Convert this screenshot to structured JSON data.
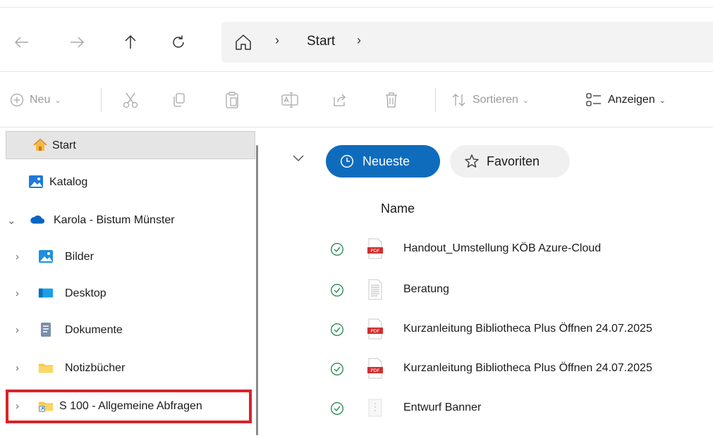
{
  "nav": {
    "breadcrumb": [
      "Start"
    ]
  },
  "toolbar": {
    "new_label": "Neu",
    "sort_label": "Sortieren",
    "view_label": "Anzeigen"
  },
  "sidebar": {
    "items": [
      {
        "label": "Start",
        "icon": "home-icon",
        "selected": true
      },
      {
        "label": "Katalog",
        "icon": "gallery-icon"
      },
      {
        "label": "Karola - Bistum Münster",
        "icon": "onedrive-cloud-icon",
        "expanded": true
      },
      {
        "label": "Bilder",
        "icon": "pictures-folder-icon"
      },
      {
        "label": "Desktop",
        "icon": "desktop-folder-icon"
      },
      {
        "label": "Dokumente",
        "icon": "documents-folder-icon"
      },
      {
        "label": "Notizbücher",
        "icon": "folder-icon"
      },
      {
        "label": "S 100 - Allgemeine Abfragen",
        "icon": "shortcut-folder-icon",
        "highlighted": true
      }
    ]
  },
  "main": {
    "tabs": [
      {
        "label": "Neueste",
        "icon": "clock-icon",
        "active": true
      },
      {
        "label": "Favoriten",
        "icon": "star-icon",
        "active": false
      }
    ],
    "column_header": "Name",
    "files": [
      {
        "name": "Handout_Umstellung KÖB Azure-Cloud",
        "type": "pdf"
      },
      {
        "name": "Beratung",
        "type": "text"
      },
      {
        "name": "Kurzanleitung Bibliotheca Plus Öffnen 24.07.2025",
        "type": "pdf"
      },
      {
        "name": "Kurzanleitung Bibliotheca Plus Öffnen 24.07.2025",
        "type": "pdf"
      },
      {
        "name": "Entwurf Banner",
        "type": "image"
      }
    ]
  },
  "colors": {
    "accent": "#0f6cbd",
    "sync_ok": "#2e8b57",
    "highlight": "#d9232a",
    "pdf_red": "#d32f2f"
  }
}
